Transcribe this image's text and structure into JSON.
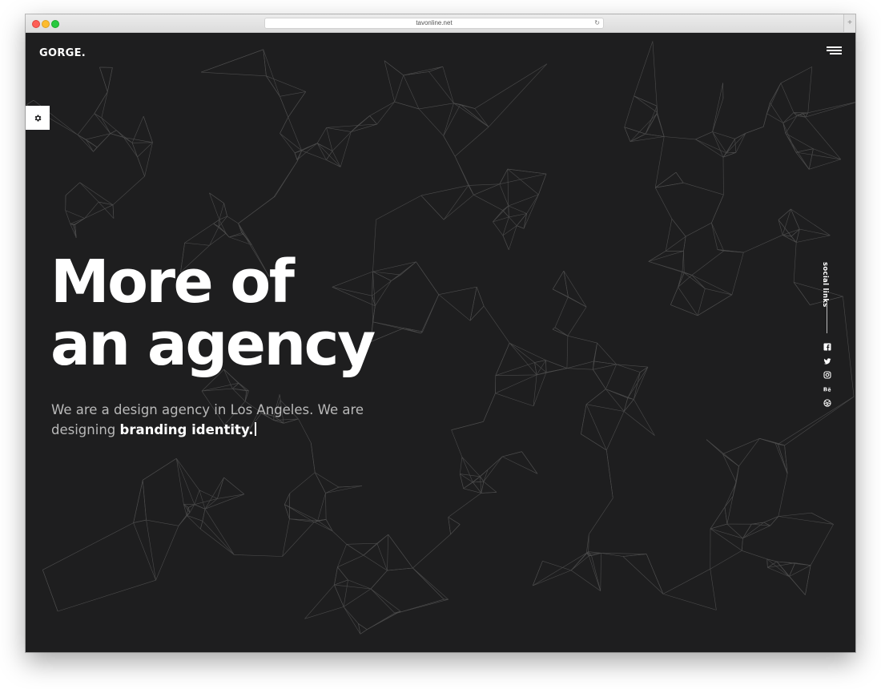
{
  "browser": {
    "url": "tavonline.net",
    "reload_glyph": "↻",
    "new_tab_glyph": "+"
  },
  "site": {
    "logo": "GORGE.",
    "menu_icon": "hamburger-menu-icon",
    "settings_icon": "gear-icon"
  },
  "hero": {
    "title_line1": "More of",
    "title_line2": "an agency",
    "subtitle_plain": "We are a design agency in Los Angeles. We are designing",
    "subtitle_bold": "branding identity."
  },
  "social": {
    "label": "social links",
    "icons": [
      "facebook-icon",
      "twitter-icon",
      "instagram-icon",
      "behance-icon",
      "dribbble-icon"
    ]
  },
  "colors": {
    "background": "#1e1e1f",
    "text": "#ffffff",
    "muted_text": "#b9b9b9",
    "network_lines": "#5a5a5a"
  }
}
